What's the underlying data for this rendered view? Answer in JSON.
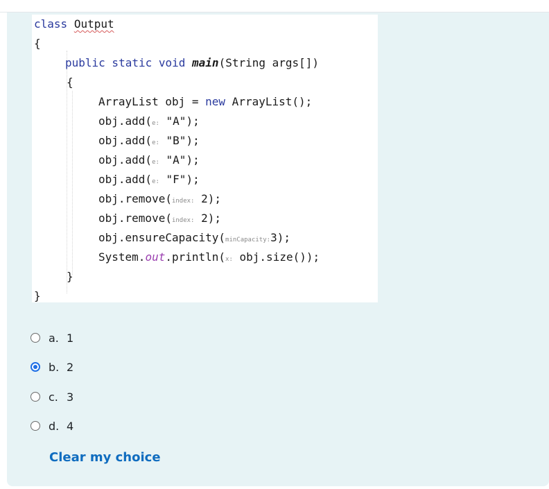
{
  "code": {
    "line1_kw": "class",
    "line1_name": "Output",
    "brace_open": "{",
    "method_sig": "public static void",
    "method_name": "main",
    "method_params": "(String args[])",
    "inner_open": "{",
    "decl_left": "ArrayList obj",
    "decl_eq": " = ",
    "decl_new": "new",
    "decl_right": " ArrayList();",
    "add1_pre": "obj.add(",
    "add1_hint": "e:",
    "add1_arg": " \"A\");",
    "add2_pre": "obj.add(",
    "add2_hint": "e:",
    "add2_arg": " \"B\");",
    "add3_pre": "obj.add(",
    "add3_hint": "e:",
    "add3_arg": " \"A\");",
    "add4_pre": "obj.add(",
    "add4_hint": "e:",
    "add4_arg": " \"F\");",
    "rem1_pre": "obj.remove(",
    "rem1_hint": "index:",
    "rem1_arg": " 2);",
    "rem2_pre": "obj.remove(",
    "rem2_hint": "index:",
    "rem2_arg": " 2);",
    "ens_pre": "obj.ensureCapacity(",
    "ens_hint": "minCapacity:",
    "ens_arg": "3);",
    "print_pre": "System.",
    "print_field": "out",
    "print_mid": ".println(",
    "print_hint": "x:",
    "print_arg": " obj.size());",
    "inner_close": "}",
    "brace_close": "}"
  },
  "options": [
    {
      "letter": "a.",
      "text": "1",
      "selected": false
    },
    {
      "letter": "b.",
      "text": "2",
      "selected": true
    },
    {
      "letter": "c.",
      "text": "3",
      "selected": false
    },
    {
      "letter": "d.",
      "text": "4",
      "selected": false
    }
  ],
  "clear_choice_label": "Clear my choice",
  "colors": {
    "panel_bg": "#e7f3f5",
    "link": "#0f6cbf",
    "radio_checked": "#1f6fe5",
    "keyword": "#2a3a9e",
    "static_field": "#9b3fb0"
  }
}
